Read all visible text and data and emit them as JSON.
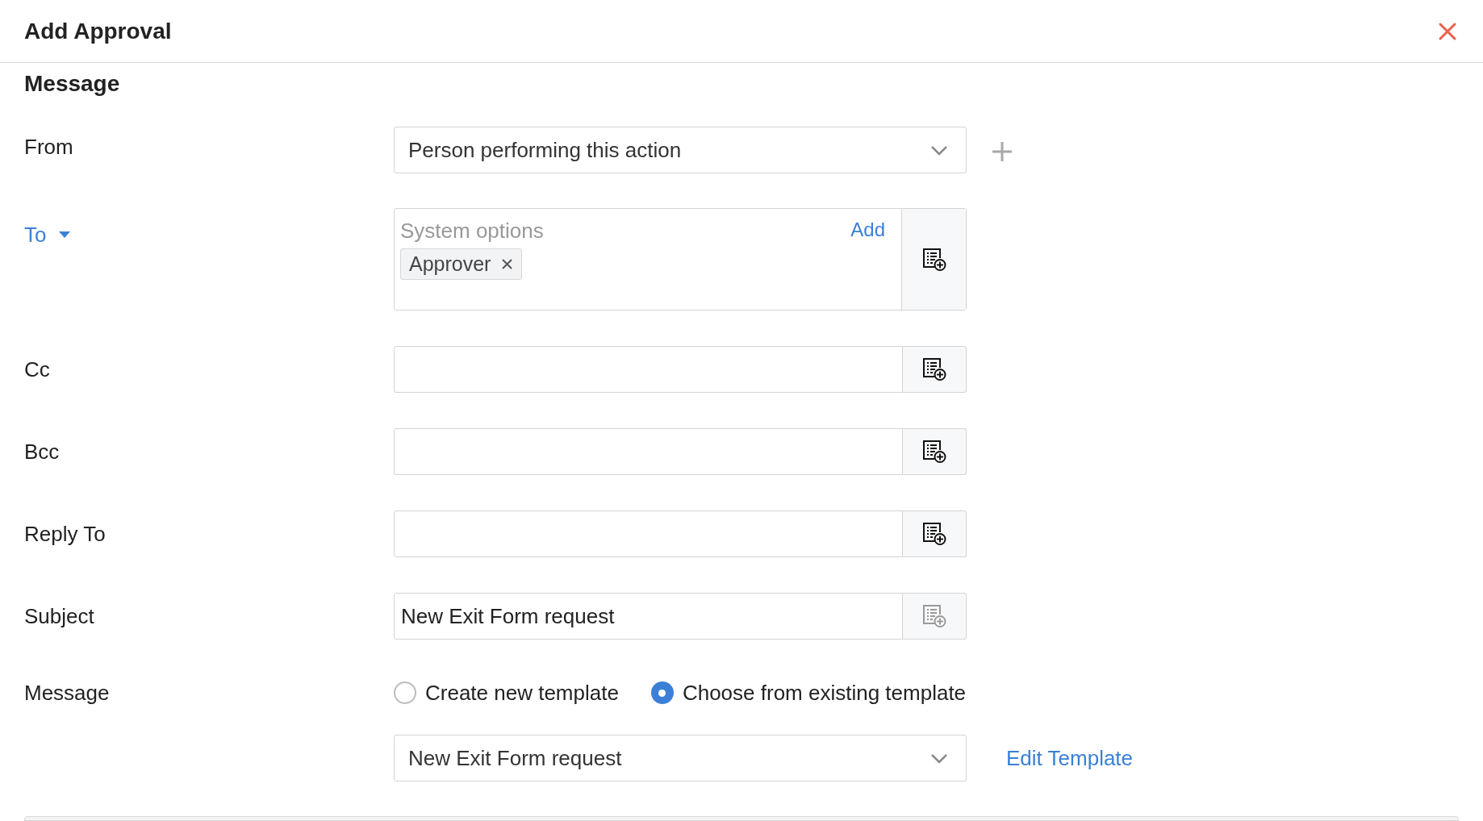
{
  "dialog": {
    "title": "Add Approval"
  },
  "section": {
    "heading": "Message"
  },
  "rows": [
    {
      "kind": "select",
      "label": "From",
      "value": "Person performing this action"
    },
    {
      "kind": "recipients",
      "label": "To",
      "placeholder": "System options",
      "add_link": "Add",
      "chips": [
        {
          "label": "Approver"
        }
      ]
    },
    {
      "kind": "input",
      "label": "Cc",
      "picker_disabled": false
    },
    {
      "kind": "input",
      "label": "Bcc",
      "picker_disabled": false
    },
    {
      "kind": "input",
      "label": "Reply To",
      "picker_disabled": false
    },
    {
      "kind": "input",
      "label": "Subject",
      "value": "New Exit Form request",
      "picker_disabled": true
    }
  ],
  "message": {
    "label": "Message",
    "options": [
      {
        "label": "Create new template",
        "selected": false
      },
      {
        "label": "Choose from existing template",
        "selected": true
      }
    ],
    "template": "New Exit Form request",
    "edit_link": "Edit Template"
  }
}
